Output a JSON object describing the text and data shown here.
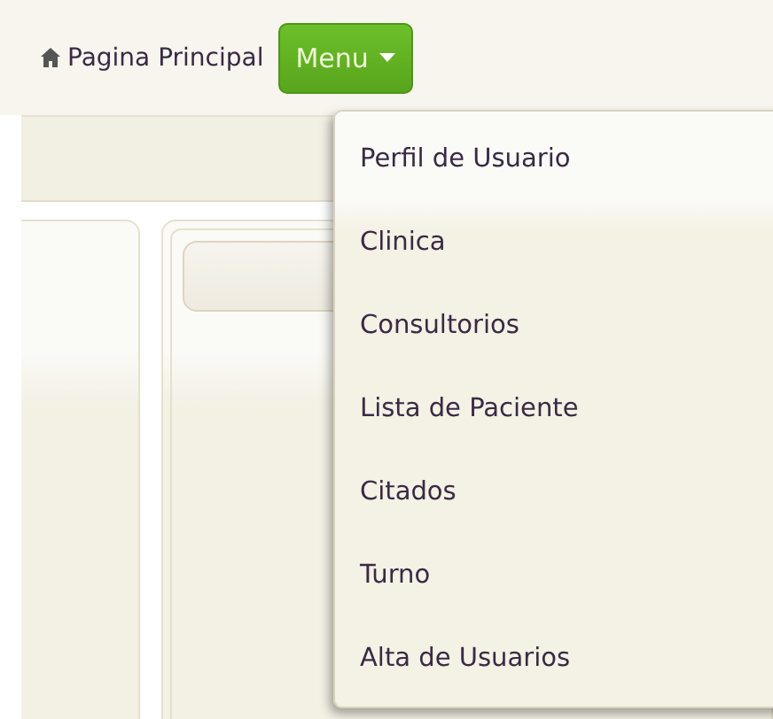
{
  "nav": {
    "home_link": "Pagina Principal",
    "menu_button": {
      "label": "Menu",
      "expanded": true
    }
  },
  "menu_items": [
    {
      "label": "Perfil de Usuario"
    },
    {
      "label": "Clinica"
    },
    {
      "label": "Consultorios"
    },
    {
      "label": "Lista de Paciente"
    },
    {
      "label": "Citados"
    },
    {
      "label": "Turno"
    },
    {
      "label": "Alta de Usuarios"
    }
  ]
}
